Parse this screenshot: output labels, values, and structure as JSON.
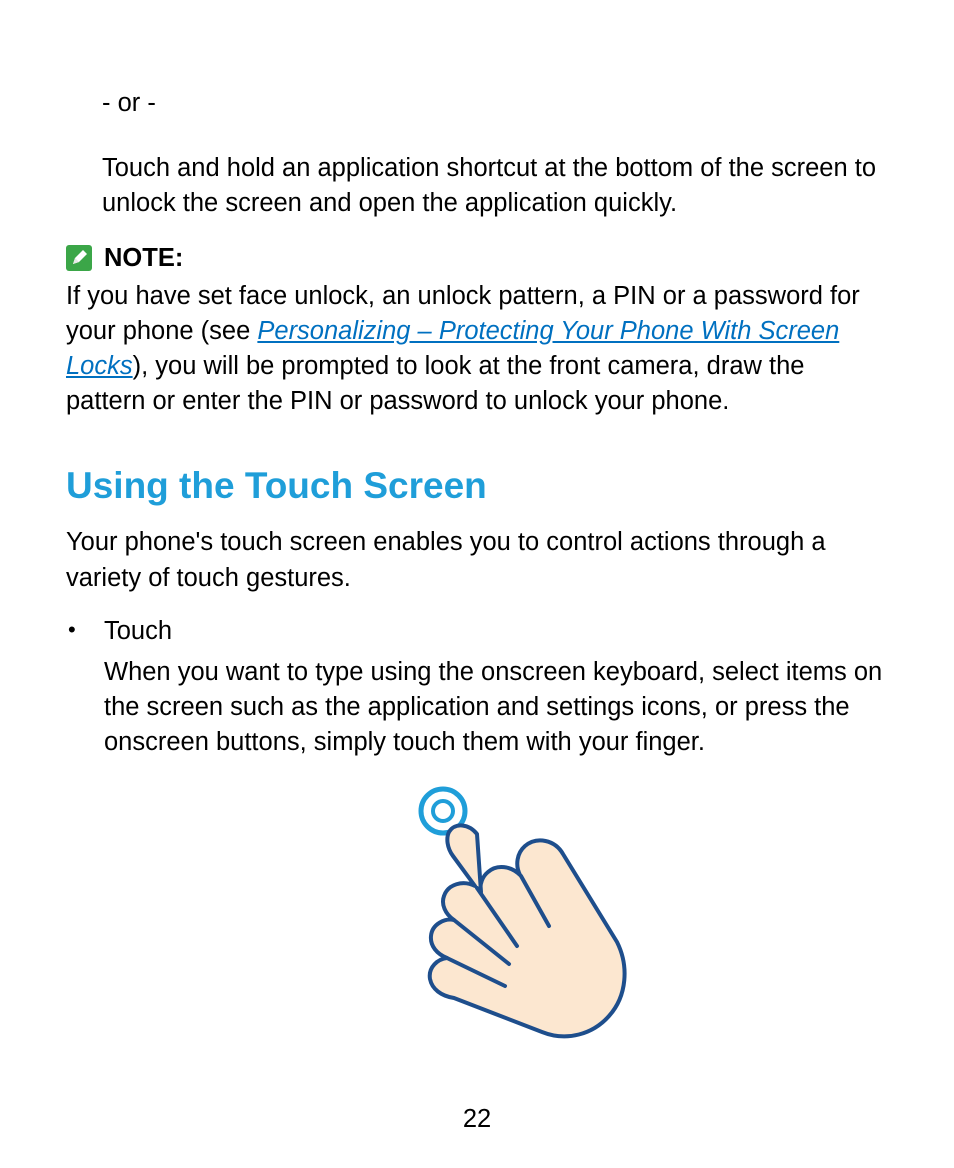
{
  "intro_or": "- or -",
  "intro_para": "Touch and hold an application shortcut at the bottom of the screen to unlock the screen and open the application quickly.",
  "note": {
    "label": "NOTE:",
    "part1": "If you have set face unlock, an unlock pattern, a PIN or a password for your phone (see ",
    "link": "Personalizing – Protecting Your Phone With Screen Locks",
    "part2": "), you will be prompted to look at the front camera, draw the pattern or enter the PIN or password to unlock your phone."
  },
  "section": {
    "heading": "Using the Touch Screen",
    "intro": "Your phone's touch screen enables you to control actions through a variety of touch gestures.",
    "bullet": {
      "title": "Touch",
      "body": "When you want to type using the onscreen keyboard, select items on the screen such as the application and settings icons, or press the onscreen buttons, simply touch them with your finger."
    }
  },
  "page_number": "22"
}
